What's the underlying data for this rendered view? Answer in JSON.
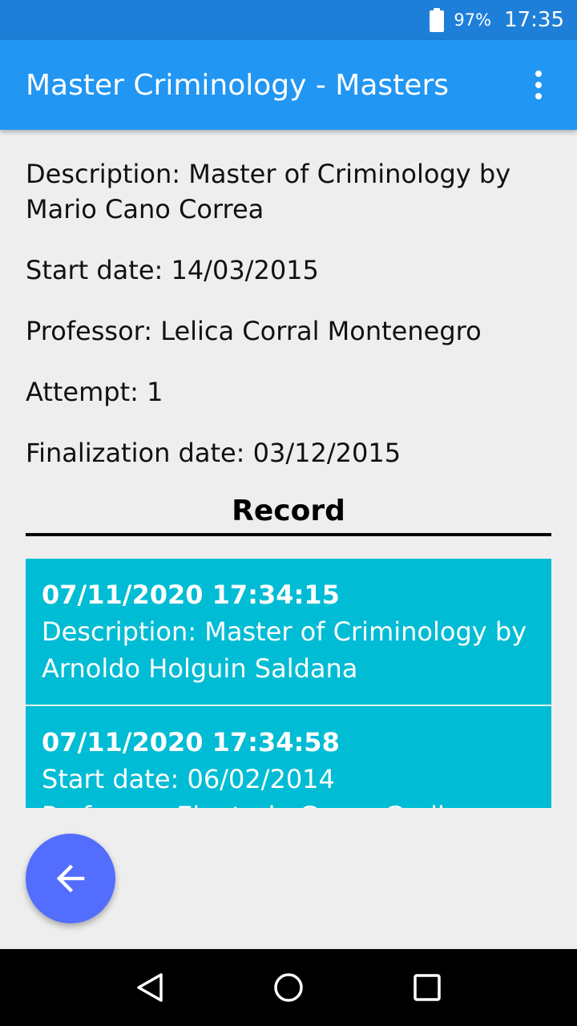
{
  "status_bar": {
    "battery_icon": "battery-icon",
    "battery_percent": "97%",
    "time": "17:35"
  },
  "app_bar": {
    "title": "Master Criminology - Masters",
    "overflow_icon": "more-vert-icon"
  },
  "details": {
    "description": "Description: Master of Criminology by Mario Cano Correa",
    "start_date": "Start date: 14/03/2015",
    "professor": "Professor: Lelica Corral Montenegro",
    "attempt": "Attempt: 1",
    "finalization_date": "Finalization date: 03/12/2015"
  },
  "record": {
    "heading": "Record",
    "items": [
      {
        "timestamp": "07/11/2020 17:34:15",
        "line1": "Description: Master of Criminology by",
        "line2": "Arnoldo Holguin Saldana"
      },
      {
        "timestamp": "07/11/2020 17:34:58",
        "line1": "Start date: 06/02/2014",
        "line2": "Professor: Eleuterio Garay Garibay"
      }
    ]
  },
  "fab": {
    "icon": "arrow-back-icon"
  },
  "nav_bar": {
    "back_icon": "nav-back-icon",
    "home_icon": "nav-home-icon",
    "recents_icon": "nav-recents-icon"
  },
  "colors": {
    "status_bar": "#1e7fd9",
    "app_bar": "#2196f3",
    "record_item": "#00bcd4",
    "fab": "#536dfe"
  }
}
